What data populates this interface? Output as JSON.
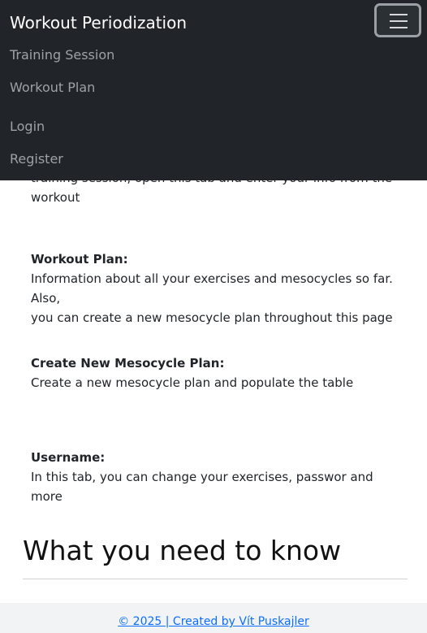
{
  "navbar": {
    "brand": "Workout Periodization",
    "links": [
      "Training Session",
      "Workout Plan"
    ],
    "auth": [
      "Login",
      "Register"
    ]
  },
  "main": {
    "partial_text": "training session, open this tab and enter your info from the",
    "partial_text_end": "workout",
    "items": [
      {
        "title": "Workout Plan:",
        "text_line1": "Information about all your exercises and mesocycles so far. Also,",
        "text_line2": "you can create a new mesocycle plan throughout this page"
      },
      {
        "title": "Create New Mesocycle Plan:",
        "text_line1": "Create a new mesocycle plan and populate the table"
      },
      {
        "title": "Username:",
        "text_line1": "In this tab, you can change your exercises, passwor and more"
      }
    ],
    "section_heading": "What you need to know"
  },
  "footer": {
    "text": "© 2025 | Created by Vít Puskajler"
  }
}
